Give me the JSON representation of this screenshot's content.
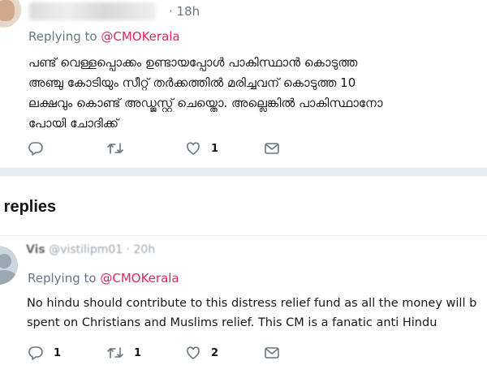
{
  "tweet": {
    "time": "18h",
    "replying_prefix": "Replying to",
    "replying_handle": "@CMOKerala",
    "text_lines": [
      "പണ്ട് വെള്ളപ്പൊക്കം ഉണ്ടായപ്പോൾ പാകിസ്ഥാൻ കൊടുത്ത",
      "അഞ്ചു കോടിയും സീറ്റ് തർക്കത്തിൽ മരിച്ചവന് കൊടുത്ത 10",
      "ലക്ഷവും കൊണ്ട് അഡ്ജസ്റ്റ് ചെയ്തൊ. അല്ലെങ്കിൽ പാകിസ്ഥാനോ",
      "പോയി ചോദിക്ക്"
    ],
    "actions": {
      "reply_count": "",
      "retweet_count": "",
      "like_count": "1"
    }
  },
  "replies_section": {
    "heading": "e replies"
  },
  "reply": {
    "name": "Vis",
    "handle": "@vistilipm01",
    "time": "20h",
    "replying_prefix": "Replying to",
    "replying_handle": "@CMOKerala",
    "text_lines": [
      "No hindu should contribute to this distress relief fund as all the money will b",
      "spent on Christians and Muslims relief. This CM is a fanatic anti Hindu"
    ],
    "actions": {
      "reply_count": "1",
      "retweet_count": "1",
      "like_count": "2"
    }
  },
  "colors": {
    "mention": "#e0245e",
    "muted": "#657786",
    "divider": "#e6ecf0"
  },
  "icons": [
    "reply-icon",
    "retweet-icon",
    "like-icon",
    "direct-message-icon"
  ]
}
